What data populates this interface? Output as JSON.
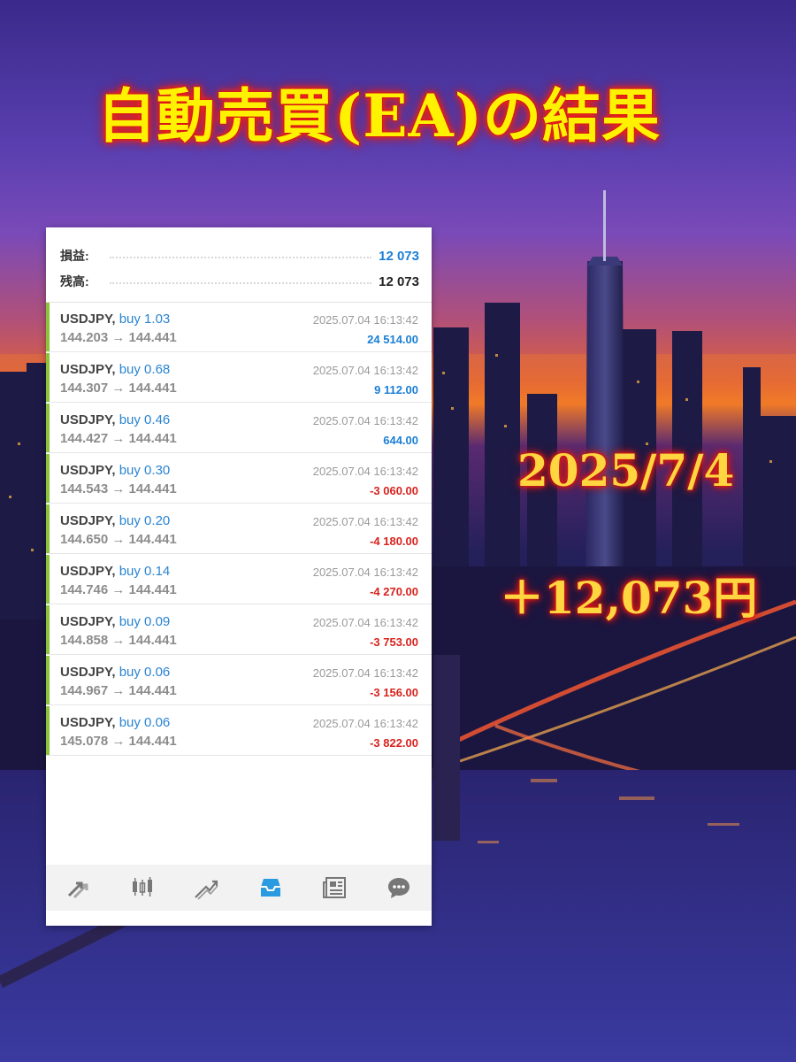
{
  "headline": "自動売買(EA)の結果",
  "overlay": {
    "date": "2025/7/4",
    "profit": "＋12,073円"
  },
  "summary": {
    "profit_label": "損益:",
    "profit_value": "12 073",
    "balance_label": "残高:",
    "balance_value": "12 073"
  },
  "trades": [
    {
      "symbol": "USDJPY,",
      "side": "buy 1.03",
      "prices": "144.203 → 144.441",
      "time": "2025.07.04 16:13:42",
      "pl": "24 514.00"
    },
    {
      "symbol": "USDJPY,",
      "side": "buy 0.68",
      "prices": "144.307 → 144.441",
      "time": "2025.07.04 16:13:42",
      "pl": "9 112.00"
    },
    {
      "symbol": "USDJPY,",
      "side": "buy 0.46",
      "prices": "144.427 → 144.441",
      "time": "2025.07.04 16:13:42",
      "pl": "644.00"
    },
    {
      "symbol": "USDJPY,",
      "side": "buy 0.30",
      "prices": "144.543 → 144.441",
      "time": "2025.07.04 16:13:42",
      "pl": "-3 060.00"
    },
    {
      "symbol": "USDJPY,",
      "side": "buy 0.20",
      "prices": "144.650 → 144.441",
      "time": "2025.07.04 16:13:42",
      "pl": "-4 180.00"
    },
    {
      "symbol": "USDJPY,",
      "side": "buy 0.14",
      "prices": "144.746 → 144.441",
      "time": "2025.07.04 16:13:42",
      "pl": "-4 270.00"
    },
    {
      "symbol": "USDJPY,",
      "side": "buy 0.09",
      "prices": "144.858 → 144.441",
      "time": "2025.07.04 16:13:42",
      "pl": "-3 753.00"
    },
    {
      "symbol": "USDJPY,",
      "side": "buy 0.06",
      "prices": "144.967 → 144.441",
      "time": "2025.07.04 16:13:42",
      "pl": "-3 156.00"
    },
    {
      "symbol": "USDJPY,",
      "side": "buy 0.06",
      "prices": "145.078 → 144.441",
      "time": "2025.07.04 16:13:42",
      "pl": "-3 822.00"
    }
  ],
  "toolbar": [
    {
      "icon": "quotes-arrows-icon",
      "active": false
    },
    {
      "icon": "candlestick-chart-icon",
      "active": false
    },
    {
      "icon": "trade-lines-icon",
      "active": false
    },
    {
      "icon": "inbox-history-icon",
      "active": true
    },
    {
      "icon": "news-icon",
      "active": false
    },
    {
      "icon": "chat-bubble-icon",
      "active": false
    }
  ],
  "colors": {
    "profit": "#1a7fd6",
    "loss": "#d8231e",
    "neutral": "#222222",
    "accent_bar": "#8ac23a",
    "active_icon": "#2a9be0",
    "inactive_icon": "#777777"
  }
}
